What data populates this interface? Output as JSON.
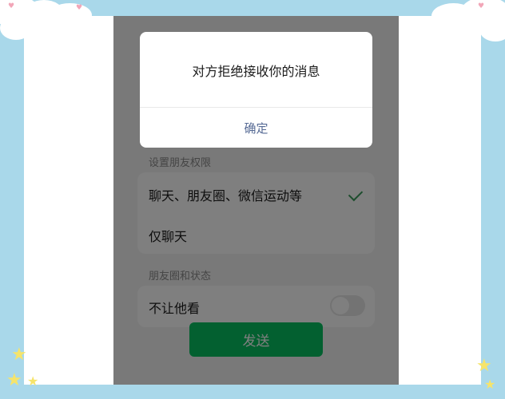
{
  "colors": {
    "background": "#a9d8ea",
    "accent_green": "#07c160",
    "check_green": "#3b9a5c",
    "dialog_button": "#576b95"
  },
  "dialog": {
    "message": "对方拒绝接收你的消息",
    "confirm_label": "确定"
  },
  "permissions": {
    "section_label": "设置朋友权限",
    "options": [
      {
        "label": "聊天、朋友圈、微信运动等",
        "selected": true
      },
      {
        "label": "仅聊天",
        "selected": false
      }
    ]
  },
  "moments": {
    "section_label": "朋友圈和状态",
    "rows": [
      {
        "label": "不让他看",
        "toggle_on": false
      }
    ]
  },
  "send_button": {
    "label": "发送"
  },
  "icons": [
    "check-icon",
    "toggle-switch",
    "star-icon",
    "heart-icon"
  ]
}
